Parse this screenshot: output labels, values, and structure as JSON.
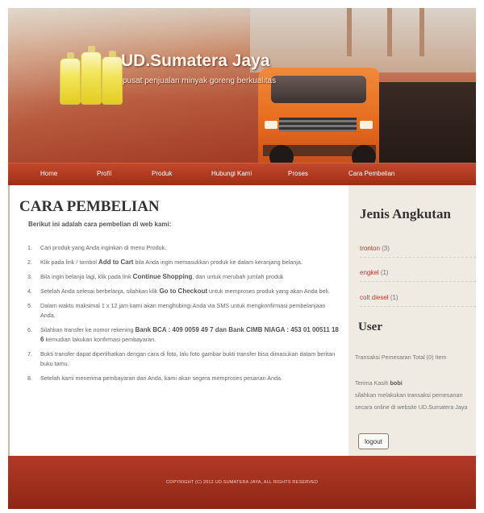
{
  "header": {
    "brand_title": "UD.Sumatera Jaya",
    "tagline": "pusat penjualan minyak goreng berkualitas"
  },
  "nav": {
    "items": [
      {
        "label": "Home"
      },
      {
        "label": "Profil"
      },
      {
        "label": "Produk"
      },
      {
        "label": "Hubungi Kami"
      },
      {
        "label": "Proses"
      },
      {
        "label": "Cara Pembelian"
      }
    ]
  },
  "main": {
    "title": "CARA PEMBELIAN",
    "intro": "Berikut ini adalah cara pembelian di web kami:",
    "steps": [
      {
        "num": "1.",
        "parts": [
          "Cari produk yang Anda inginkan di menu Produk."
        ]
      },
      {
        "num": "2.",
        "parts": [
          "Klik pada link / tombol ",
          "Add to Cart",
          " bila Anda ingin memasukkan produk ke dalam keranjang belanja."
        ]
      },
      {
        "num": "3.",
        "parts": [
          "Bila ingin belanja lagi, klik pada link ",
          "Continue Shopping",
          ", dan untuk merubah jumlah produk"
        ]
      },
      {
        "num": "4.",
        "parts": [
          "Setelah Anda selesai berbelanja, silahkan klik ",
          "Go to Checkout",
          " untuk memproses produk yang akan Anda beli."
        ]
      },
      {
        "num": "5.",
        "parts": [
          "Dalam waktu maksimal 1 x 12 jam kami akan menghubingi Anda via SMS untuk mengkonfirmasi pembelanjaan Anda."
        ]
      },
      {
        "num": "6.",
        "parts": [
          "Silahkan transfer ke nomor rekening ",
          "Bank BCA : 409 0059 49 7 dan Bank CIMB NIAGA : 453 01 00511 18 6",
          " kemudian lakukan konfirmasi pembayaran."
        ]
      },
      {
        "num": "7.",
        "parts": [
          "Bukti transfer dapat diperlihatkan dengan cara di foto, lalu foto gambar bukti transfer bisa dimasukan dalam beritan buku tamu."
        ]
      },
      {
        "num": "8.",
        "parts": [
          "Setelah kami menerima pembayaran dari Anda, kami akan segera memproses pesanan Anda."
        ]
      }
    ]
  },
  "sidebar": {
    "jenis_heading": "Jenis Angkutan",
    "categories": [
      {
        "name": "tronton",
        "count": "(3)"
      },
      {
        "name": "engkel",
        "count": "(1)"
      },
      {
        "name": "colt diesel",
        "count": "(1)"
      }
    ],
    "user_heading": "User",
    "order_summary": "Transaksi Pemesaran Total (0) Item",
    "thanks_prefix": "Terima Kasih ",
    "username": "bobi",
    "thanks_message": "silahkan melakukan transaksi pemesanan secara online di website UD.Sumatera Jaya",
    "logout_label": "logout"
  },
  "footer": {
    "copyright": "COPYRIGHT (C) 2012 UD.SUMATERA JAYA, ALL RIGHTS RESERVED"
  },
  "colors": {
    "nav_bar": "#b13a26",
    "footer": "#a03020",
    "sidebar_bg": "#efebe3",
    "category_link": "#c0392b"
  }
}
